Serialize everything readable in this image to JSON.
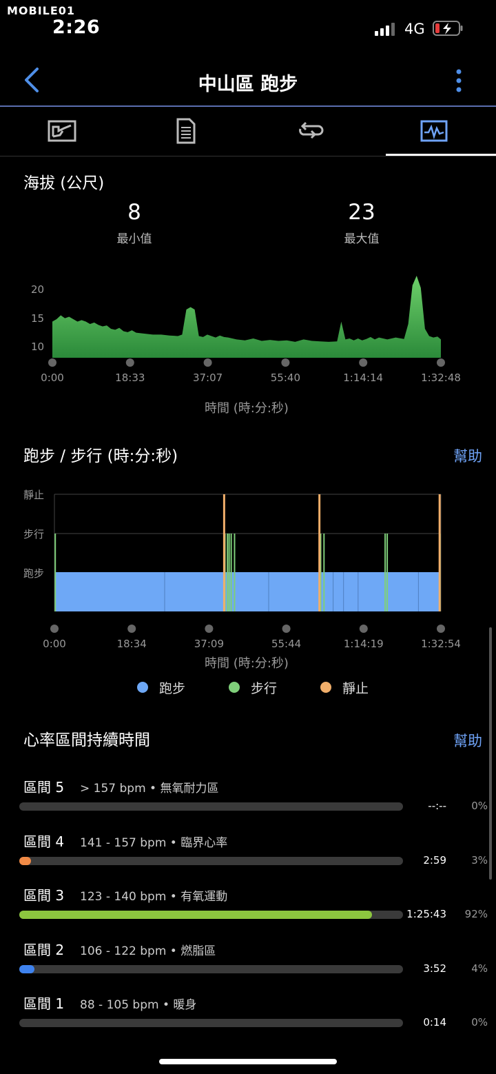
{
  "status": {
    "watermark": "MOBILE01",
    "time": "2:26",
    "network": "4G"
  },
  "header": {
    "title": "中山區 跑步",
    "back_icon": "chevron-left-icon",
    "more_icon": "more-vertical-icon",
    "accent": "#4f8fe8"
  },
  "tabs": [
    {
      "icon": "map-icon",
      "active": false
    },
    {
      "icon": "document-icon",
      "active": false
    },
    {
      "icon": "laps-icon",
      "active": false
    },
    {
      "icon": "chart-icon",
      "active": true
    }
  ],
  "elevation": {
    "title": "海拔 (公尺)",
    "min_value": "8",
    "min_label": "最小值",
    "max_value": "23",
    "max_label": "最大值",
    "chart_data": {
      "type": "area",
      "ylabel": "海拔 (公尺)",
      "xlabel": "時間 (時:分:秒)",
      "y_ticks": [
        "20",
        "15",
        "10"
      ],
      "x_ticks": [
        "0:00",
        "18:33",
        "37:07",
        "55:40",
        "1:14:14",
        "1:32:48"
      ],
      "ylim": [
        5,
        22
      ],
      "x_minutes": [
        0,
        1,
        2,
        3,
        4,
        5,
        6,
        7,
        8,
        9,
        10,
        11,
        12,
        13,
        14,
        15,
        16,
        17,
        18,
        19,
        20,
        22,
        24,
        26,
        28,
        30,
        31,
        32,
        33,
        34,
        35,
        36,
        37,
        38,
        39,
        40,
        41,
        42,
        44,
        46,
        48,
        50,
        52,
        54,
        56,
        58,
        60,
        62,
        64,
        66,
        68,
        69,
        70,
        71,
        72,
        73,
        74,
        75,
        76,
        77,
        78,
        80,
        82,
        84,
        85,
        86,
        87,
        88,
        89,
        90,
        91,
        92,
        92.8
      ],
      "values": [
        12.5,
        13,
        13.8,
        13.2,
        13.5,
        13,
        12.5,
        12.8,
        12.5,
        12,
        12.3,
        11.8,
        11.5,
        11.7,
        11,
        10.8,
        11.2,
        10.5,
        10.3,
        10.7,
        10.2,
        10,
        9.8,
        9.8,
        9.6,
        9.5,
        9.8,
        15,
        15.5,
        15,
        9.5,
        9.3,
        9.8,
        9.5,
        9.2,
        9.6,
        9.3,
        9.2,
        8.8,
        8.6,
        9,
        8.5,
        8.7,
        8.5,
        8.6,
        8.3,
        8.8,
        8.5,
        8.4,
        8.3,
        8.4,
        12.5,
        8.8,
        9,
        8.6,
        9,
        8.6,
        8.9,
        9.3,
        8.8,
        9.2,
        8.8,
        9.2,
        8.9,
        12,
        20,
        22,
        19.5,
        11,
        9.5,
        9.2,
        9.4,
        8.8
      ],
      "colors": {
        "fill_top": "#6ed06a",
        "fill_bottom": "#2b8a3a"
      }
    }
  },
  "run_walk": {
    "title": "跑步 / 步行 (時:分:秒)",
    "help_label": "幫助",
    "chart_data": {
      "type": "bar",
      "categories": [
        "靜止",
        "步行",
        "跑步"
      ],
      "x_ticks": [
        "0:00",
        "18:34",
        "37:09",
        "55:44",
        "1:14:19",
        "1:32:54"
      ],
      "xlabel": "時間 (時:分:秒)",
      "xlim_minutes": [
        0,
        92.9
      ],
      "run_segments": [
        [
          0.3,
          92.5
        ]
      ],
      "walk_marks": [
        0.2,
        41.0,
        41.6,
        42.0,
        42.5,
        43.3,
        64.0,
        64.8,
        79.5,
        80.0,
        92.7
      ],
      "stop_marks": [
        40.8,
        63.7,
        92.6
      ],
      "split_marks": [
        26.5,
        51.5,
        67.0,
        69.5,
        73.0,
        87.5
      ],
      "legend": [
        {
          "label": "跑步",
          "color": "#6ea8f6"
        },
        {
          "label": "步行",
          "color": "#7fcf7a"
        },
        {
          "label": "靜止",
          "color": "#f0ae6a"
        }
      ]
    }
  },
  "hr_zones": {
    "title": "心率區間持續時間",
    "help_label": "幫助",
    "zones": [
      {
        "name": "區間 5",
        "range": "> 157 bpm • 無氧耐力區",
        "time": "--:--",
        "pct": "0%",
        "fraction": 0.0,
        "color": "#e64b4b"
      },
      {
        "name": "區間 4",
        "range": "141 - 157 bpm • 臨界心率",
        "time": "2:59",
        "pct": "3%",
        "fraction": 0.03,
        "color": "#f08a46"
      },
      {
        "name": "區間 3",
        "range": "123 - 140 bpm • 有氧運動",
        "time": "1:25:43",
        "pct": "92%",
        "fraction": 0.92,
        "color": "#8cc63f"
      },
      {
        "name": "區間 2",
        "range": "106 - 122 bpm • 燃脂區",
        "time": "3:52",
        "pct": "4%",
        "fraction": 0.04,
        "color": "#3e82ee"
      },
      {
        "name": "區間 1",
        "range": "88 - 105 bpm • 暖身",
        "time": "0:14",
        "pct": "0%",
        "fraction": 0.0,
        "color": "#9a9a9a"
      }
    ]
  }
}
